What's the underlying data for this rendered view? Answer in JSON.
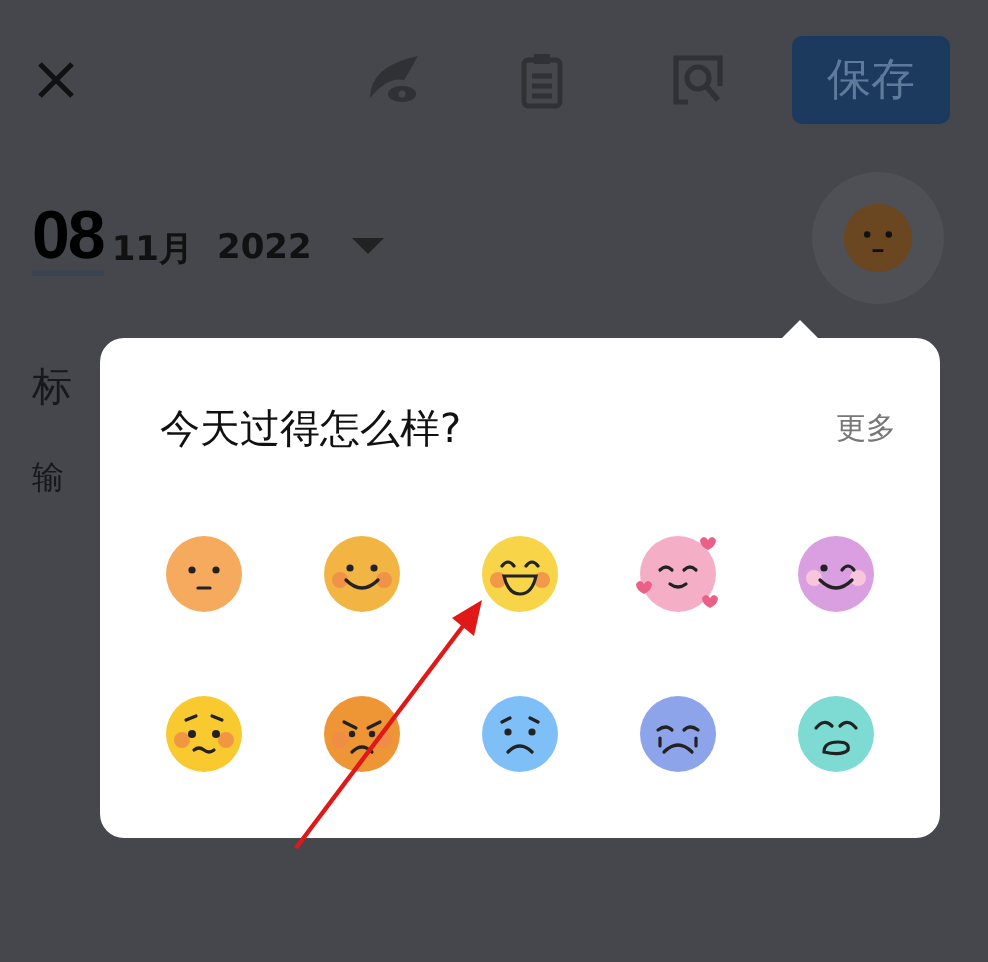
{
  "toolbar": {
    "save_label": "保存"
  },
  "date": {
    "day": "08",
    "month": "11月",
    "year": "2022"
  },
  "editor": {
    "title_hint": "标",
    "body_hint": "输"
  },
  "mood_popup": {
    "title": "今天过得怎么样?",
    "more": "更多",
    "moods": [
      {
        "kind": "neutral",
        "color": "#f6aa5e"
      },
      {
        "kind": "smile",
        "color": "#f2b543"
      },
      {
        "kind": "grin",
        "color": "#f8d449"
      },
      {
        "kind": "love",
        "color": "#f4afc6"
      },
      {
        "kind": "wink",
        "color": "#d99fe1"
      },
      {
        "kind": "worried",
        "color": "#f9ca2f"
      },
      {
        "kind": "angry",
        "color": "#ee9636"
      },
      {
        "kind": "sad",
        "color": "#7fbff7"
      },
      {
        "kind": "crying",
        "color": "#8ea4ea"
      },
      {
        "kind": "sob",
        "color": "#7edbd3"
      }
    ]
  }
}
